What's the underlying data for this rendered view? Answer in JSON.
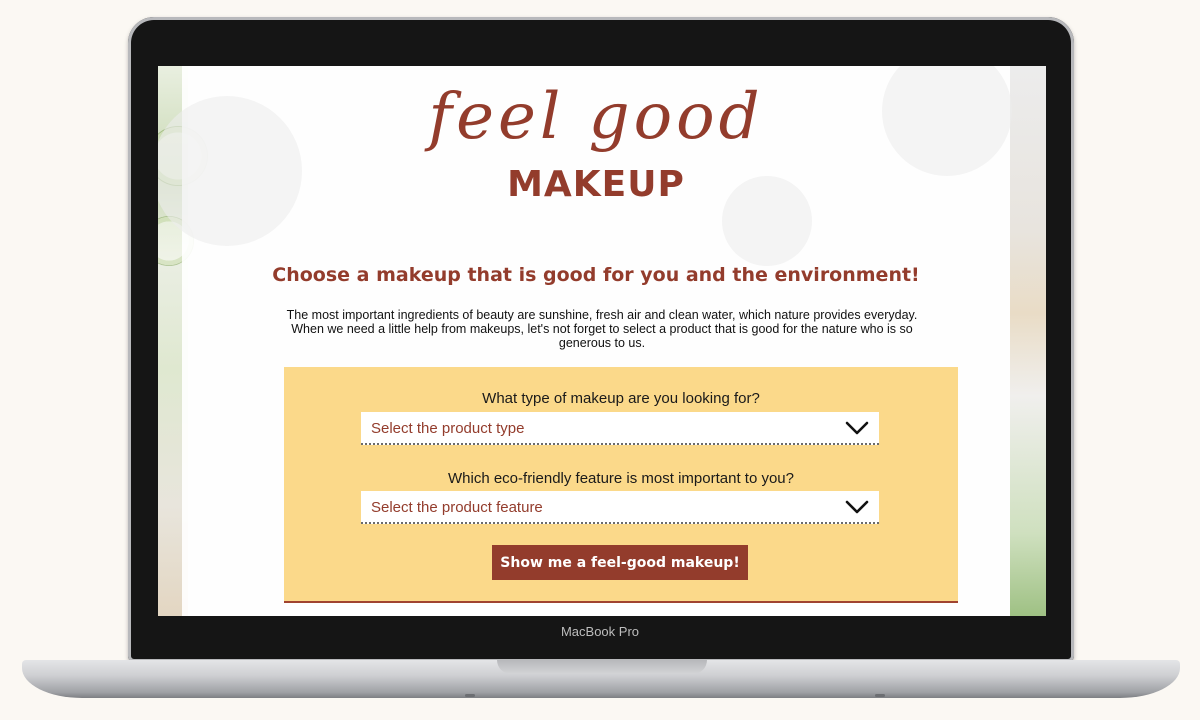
{
  "device": {
    "label": "MacBook Pro"
  },
  "page": {
    "script_title": "feel good",
    "brand_title": "MAKEUP",
    "headline": "Choose a makeup that is good for you and the environment!",
    "intro": "The most important ingredients of beauty are sunshine, fresh air and clean water, which nature provides everyday. When we need a little help from makeups, let's not forget to select a product that is good for the nature who is so generous to us."
  },
  "form": {
    "type_question": "What type of makeup are you looking for?",
    "type_select": {
      "value": "Select the product type",
      "icon": "chevron-down-icon"
    },
    "feature_question": "Which eco-friendly feature is most important to you?",
    "feature_select": {
      "value": "Select the product feature",
      "icon": "chevron-down-icon"
    },
    "submit_label": "Show me a feel-good makeup!"
  },
  "colors": {
    "brand": "#933c2c",
    "panel": "#fbd98a",
    "page_bg": "#fbf8f3"
  }
}
